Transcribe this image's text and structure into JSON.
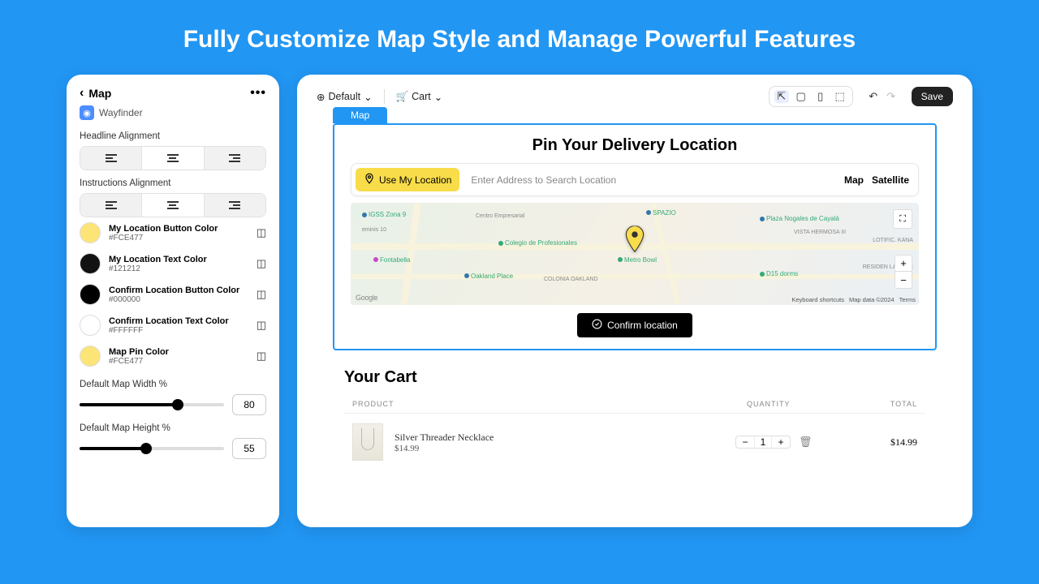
{
  "headline": "Fully Customize Map Style and Manage Powerful Features",
  "sidebar": {
    "title": "Map",
    "app_name": "Wayfinder",
    "headline_alignment_label": "Headline Alignment",
    "instructions_alignment_label": "Instructions Alignment",
    "colors": [
      {
        "name": "My Location Button Color",
        "hex": "#FCE477"
      },
      {
        "name": "My Location Text Color",
        "hex": "#121212"
      },
      {
        "name": "Confirm Location Button Color",
        "hex": "#000000"
      },
      {
        "name": "Confirm Location Text Color",
        "hex": "#FFFFFF"
      },
      {
        "name": "Map Pin Color",
        "hex": "#FCE477"
      }
    ],
    "width_label": "Default Map Width %",
    "width_value": "80",
    "height_label": "Default Map Height %",
    "height_value": "55"
  },
  "toolbar": {
    "default_label": "Default",
    "cart_label": "Cart",
    "save_label": "Save"
  },
  "map": {
    "tab_label": "Map",
    "title": "Pin Your Delivery Location",
    "use_location_label": "Use My Location",
    "search_placeholder": "Enter Address to Search Location",
    "view_map": "Map",
    "view_satellite": "Satellite",
    "confirm_label": "Confirm location",
    "footer_shortcuts": "Keyboard shortcuts",
    "footer_data": "Map data ©2024",
    "footer_terms": "Terms",
    "google": "Google",
    "pois": {
      "igss": "IGSS Zona 9",
      "fontabella": "Fontabella",
      "centro": "Centro Empresarial",
      "spazio": "SPAZIO",
      "colegio": "Colegio de Profesionales",
      "oakland": "Oakland Place",
      "colonia": "COLONIA OAKLAND",
      "metro": "Metro Bowl",
      "plaza": "Plaza Nogales de Cayalá",
      "vista": "VISTA HERMOSA III",
      "d15": "D15 dorms",
      "lotific": "LOTIFIC. KANA",
      "residen": "RESIDEN LAS LUC",
      "eminis": "eminis 10"
    }
  },
  "cart": {
    "title": "Your Cart",
    "col_product": "PRODUCT",
    "col_quantity": "QUANTITY",
    "col_total": "TOTAL",
    "item_name": "Silver Threader Necklace",
    "item_price": "$14.99",
    "item_qty": "1",
    "item_total": "$14.99"
  }
}
